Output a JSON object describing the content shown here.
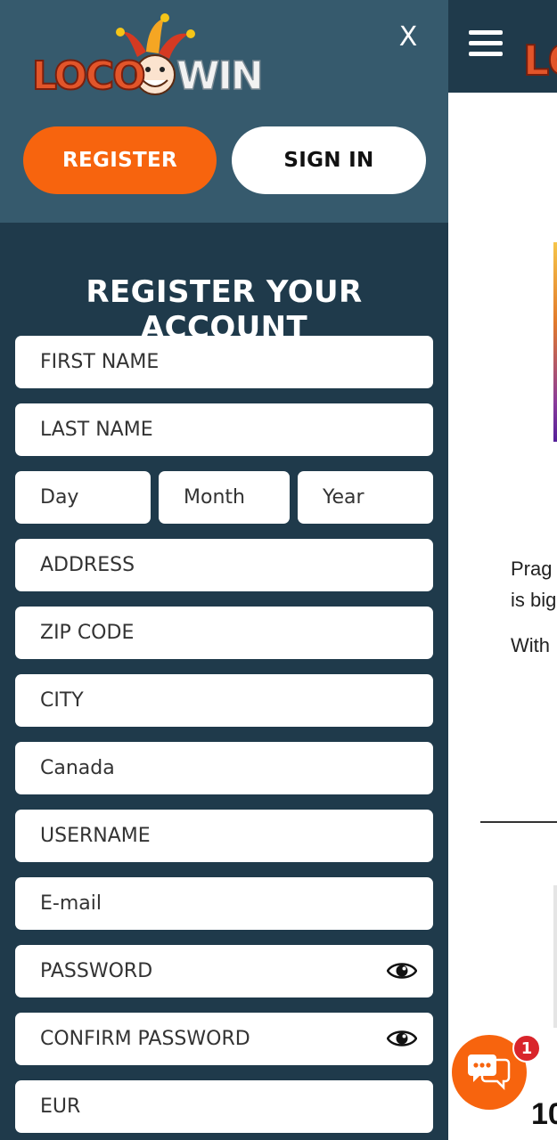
{
  "brand": {
    "logo_text_left": "LOCO",
    "logo_text_right": "WIN",
    "colors": {
      "orange": "#f7640e",
      "navy": "#1f3a4b",
      "slate": "#365a6d",
      "badge_red": "#d9252b"
    }
  },
  "drawer": {
    "close_label": "X",
    "register_label": "REGISTER",
    "signin_label": "SIGN IN"
  },
  "form": {
    "title": "REGISTER YOUR ACCOUNT",
    "first_name": "FIRST NAME",
    "last_name": "LAST NAME",
    "day": "Day",
    "month": "Month",
    "year": "Year",
    "address": "ADDRESS",
    "zip": "ZIP CODE",
    "city": "CITY",
    "country": "Canada",
    "username": "USERNAME",
    "email": "E-mail",
    "password": "PASSWORD",
    "confirm_password": "CONFIRM PASSWORD",
    "currency": "EUR"
  },
  "background": {
    "logo_fragment": "LO",
    "text_line_1": "Prag",
    "text_line_2": "is big",
    "text_line_3": "With",
    "bottom_number": "10"
  },
  "chat": {
    "badge_count": "1",
    "icon": "chat-bubbles-icon"
  }
}
